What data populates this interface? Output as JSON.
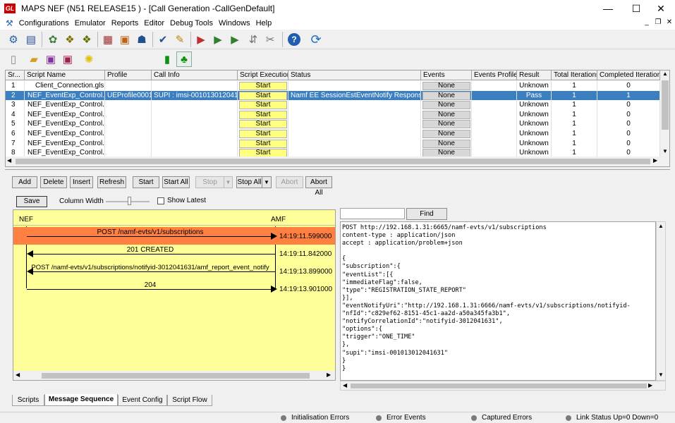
{
  "window": {
    "title": "MAPS NEF (N51 RELEASE15 ) - [Call Generation  -CallGenDefault]",
    "app_icon_text": "GL",
    "minimize": "—",
    "maximize": "☐",
    "close": "✕"
  },
  "menu": [
    "Configurations",
    "Emulator",
    "Reports",
    "Editor",
    "Debug Tools",
    "Windows",
    "Help"
  ],
  "mdi_controls": [
    "_",
    "❐",
    "✕"
  ],
  "grid": {
    "columns": [
      "Sr...",
      "Script Name",
      "Profile",
      "Call Info",
      "Script Execution",
      "Status",
      "Events",
      "Events Profile",
      "Result",
      "Total Iterations",
      "Completed Iterations"
    ],
    "rows": [
      {
        "sr": "1",
        "name": "Client_Connection.gls",
        "profile": "",
        "callinfo": "",
        "exec": "Start",
        "status": "",
        "events": "None",
        "eprofile": "",
        "result": "Unknown",
        "total": "1",
        "completed": "0"
      },
      {
        "sr": "2",
        "name": "NEF_EventExp_Control.gls",
        "profile": "UEProfile0001",
        "callinfo": "SUPI : imsi-001013012041631",
        "exec": "Start",
        "status": "Namf EE SessionEstEventNotify Response Sent",
        "events": "None",
        "eprofile": "",
        "result": "Pass",
        "total": "1",
        "completed": "1"
      },
      {
        "sr": "3",
        "name": "NEF_EventExp_Control.gls",
        "profile": "",
        "callinfo": "",
        "exec": "Start",
        "status": "",
        "events": "None",
        "eprofile": "",
        "result": "Unknown",
        "total": "1",
        "completed": "0"
      },
      {
        "sr": "4",
        "name": "NEF_EventExp_Control.gls",
        "profile": "",
        "callinfo": "",
        "exec": "Start",
        "status": "",
        "events": "None",
        "eprofile": "",
        "result": "Unknown",
        "total": "1",
        "completed": "0"
      },
      {
        "sr": "5",
        "name": "NEF_EventExp_Control.gls",
        "profile": "",
        "callinfo": "",
        "exec": "Start",
        "status": "",
        "events": "None",
        "eprofile": "",
        "result": "Unknown",
        "total": "1",
        "completed": "0"
      },
      {
        "sr": "6",
        "name": "NEF_EventExp_Control.gls",
        "profile": "",
        "callinfo": "",
        "exec": "Start",
        "status": "",
        "events": "None",
        "eprofile": "",
        "result": "Unknown",
        "total": "1",
        "completed": "0"
      },
      {
        "sr": "7",
        "name": "NEF_EventExp_Control.gls",
        "profile": "",
        "callinfo": "",
        "exec": "Start",
        "status": "",
        "events": "None",
        "eprofile": "",
        "result": "Unknown",
        "total": "1",
        "completed": "0"
      },
      {
        "sr": "8",
        "name": "NEF_EventExp_Control.gls",
        "profile": "",
        "callinfo": "",
        "exec": "Start",
        "status": "",
        "events": "None",
        "eprofile": "",
        "result": "Unknown",
        "total": "1",
        "completed": "0"
      }
    ]
  },
  "buttons": {
    "add": "Add",
    "delete": "Delete",
    "insert": "Insert",
    "refresh": "Refresh",
    "start": "Start",
    "start_all": "Start All",
    "stop": "Stop",
    "stop_all": "Stop All",
    "abort": "Abort",
    "abort_all": "Abort All"
  },
  "seq_toolbar": {
    "save": "Save",
    "column_width": "Column Width",
    "show_latest": "Show Latest"
  },
  "sequence": {
    "left_node": "NEF",
    "right_node": "AMF",
    "messages": [
      {
        "label": "POST /namf-evts/v1/subscriptions",
        "time": "14:19:11.599000",
        "direction": "right"
      },
      {
        "label": "201 CREATED",
        "time": "14:19:11.842000",
        "direction": "left"
      },
      {
        "label": "POST /namf-evts/v1/subscriptions/notifyid-3012041631/amf_report_event_notify",
        "time": "14:19:13.899000",
        "direction": "left"
      },
      {
        "label": "204",
        "time": "14:19:13.901000",
        "direction": "right"
      }
    ]
  },
  "find": {
    "value": "",
    "button": "Find"
  },
  "details": [
    "POST http://192.168.1.31:6665/namf-evts/v1/subscriptions",
    "content-type : application/json",
    "accept : application/problem+json",
    "",
    "{",
    "\"subscription\":{",
    "\"eventList\":[{",
    "\"immediateFlag\":false,",
    "\"type\":\"REGISTRATION_STATE_REPORT\"",
    "}],",
    "\"eventNotifyUri\":\"http://192.168.1.31:6666/namf-evts/v1/subscriptions/notifyid-",
    "\"nfId\":\"c829ef62-8151-45c1-aa2d-a50a345fa3b1\",",
    "\"notifyCorrelationId\":\"notifyid-3012041631\",",
    "\"options\":{",
    "\"trigger\":\"ONE_TIME\"",
    "},",
    "\"supi\":\"imsi-001013012041631\"",
    "}",
    "}"
  ],
  "tabs": [
    "Scripts",
    "Message Sequence",
    "Event Config",
    "Script Flow"
  ],
  "active_tab": "Message Sequence",
  "status_items": [
    "Initialisation Errors",
    "Error Events",
    "Captured Errors",
    "Link Status Up=0 Down=0"
  ],
  "colors": {
    "selected_row": "#3c7fc1",
    "start_button": "#ffff80",
    "seq_bg": "#ffff99",
    "highlight_msg": "#ff8040"
  }
}
